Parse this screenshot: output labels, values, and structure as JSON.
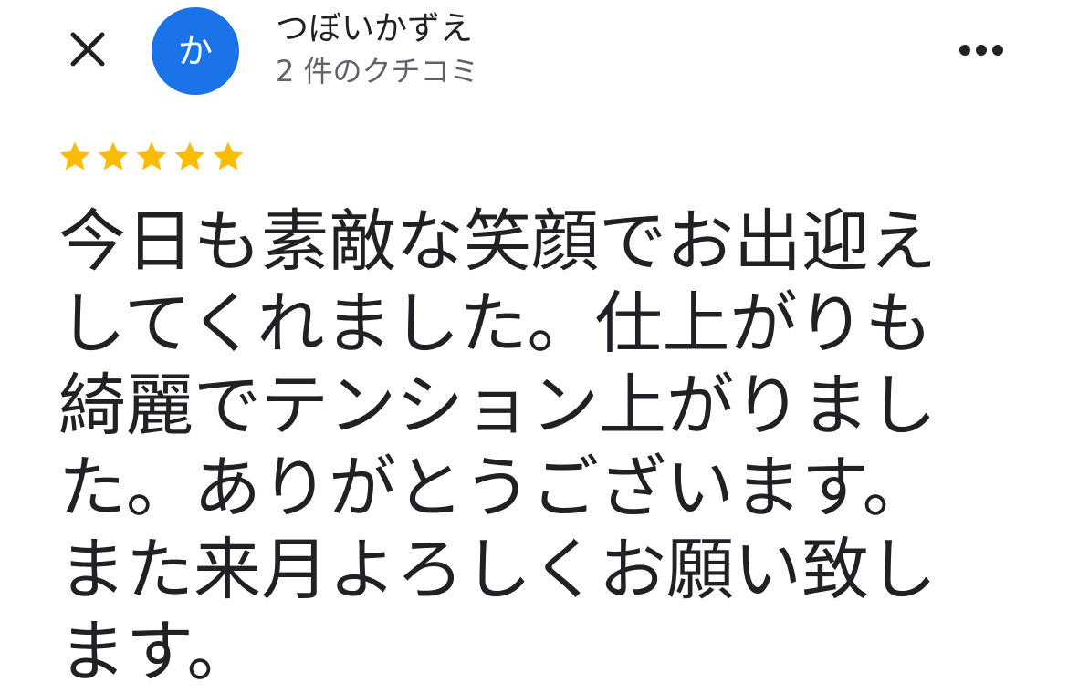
{
  "header": {
    "close_icon": "close-icon",
    "avatar_letter": "か",
    "avatar_color": "#1a73e8",
    "user_name": "つぼいかずえ",
    "review_count": "2 件のクチコミ",
    "more_icon": "more-horizontal-icon"
  },
  "review": {
    "rating": 5,
    "star_color": "#fbbc04",
    "text": "今日も素敵な笑顔でお出迎えしてくれました。仕上がりも綺麗でテンション上がりました。ありがとうございます。また来月よろしくお願い致します。"
  }
}
